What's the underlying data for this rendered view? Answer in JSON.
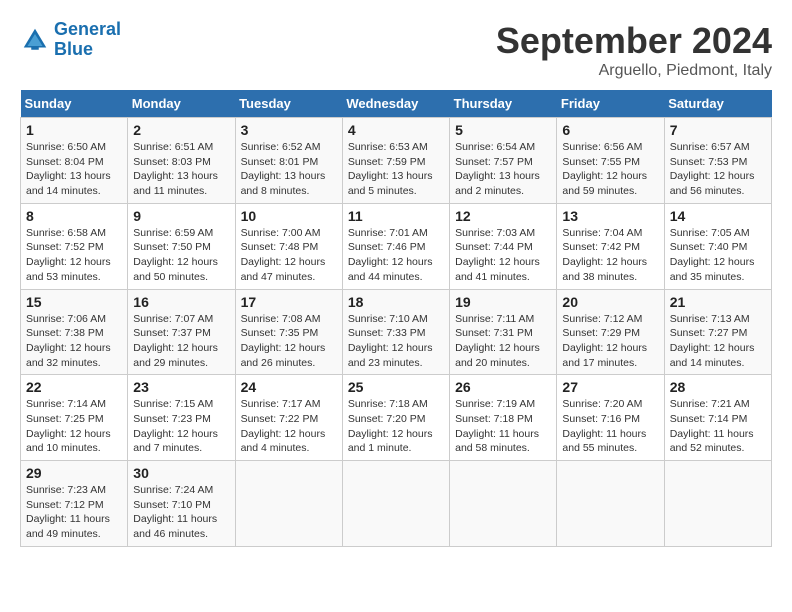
{
  "header": {
    "logo_line1": "General",
    "logo_line2": "Blue",
    "month": "September 2024",
    "location": "Arguello, Piedmont, Italy"
  },
  "weekdays": [
    "Sunday",
    "Monday",
    "Tuesday",
    "Wednesday",
    "Thursday",
    "Friday",
    "Saturday"
  ],
  "weeks": [
    [
      {
        "day": "1",
        "rise": "Sunrise: 6:50 AM",
        "set": "Sunset: 8:04 PM",
        "daylight": "Daylight: 13 hours and 14 minutes."
      },
      {
        "day": "2",
        "rise": "Sunrise: 6:51 AM",
        "set": "Sunset: 8:03 PM",
        "daylight": "Daylight: 13 hours and 11 minutes."
      },
      {
        "day": "3",
        "rise": "Sunrise: 6:52 AM",
        "set": "Sunset: 8:01 PM",
        "daylight": "Daylight: 13 hours and 8 minutes."
      },
      {
        "day": "4",
        "rise": "Sunrise: 6:53 AM",
        "set": "Sunset: 7:59 PM",
        "daylight": "Daylight: 13 hours and 5 minutes."
      },
      {
        "day": "5",
        "rise": "Sunrise: 6:54 AM",
        "set": "Sunset: 7:57 PM",
        "daylight": "Daylight: 13 hours and 2 minutes."
      },
      {
        "day": "6",
        "rise": "Sunrise: 6:56 AM",
        "set": "Sunset: 7:55 PM",
        "daylight": "Daylight: 12 hours and 59 minutes."
      },
      {
        "day": "7",
        "rise": "Sunrise: 6:57 AM",
        "set": "Sunset: 7:53 PM",
        "daylight": "Daylight: 12 hours and 56 minutes."
      }
    ],
    [
      {
        "day": "8",
        "rise": "Sunrise: 6:58 AM",
        "set": "Sunset: 7:52 PM",
        "daylight": "Daylight: 12 hours and 53 minutes."
      },
      {
        "day": "9",
        "rise": "Sunrise: 6:59 AM",
        "set": "Sunset: 7:50 PM",
        "daylight": "Daylight: 12 hours and 50 minutes."
      },
      {
        "day": "10",
        "rise": "Sunrise: 7:00 AM",
        "set": "Sunset: 7:48 PM",
        "daylight": "Daylight: 12 hours and 47 minutes."
      },
      {
        "day": "11",
        "rise": "Sunrise: 7:01 AM",
        "set": "Sunset: 7:46 PM",
        "daylight": "Daylight: 12 hours and 44 minutes."
      },
      {
        "day": "12",
        "rise": "Sunrise: 7:03 AM",
        "set": "Sunset: 7:44 PM",
        "daylight": "Daylight: 12 hours and 41 minutes."
      },
      {
        "day": "13",
        "rise": "Sunrise: 7:04 AM",
        "set": "Sunset: 7:42 PM",
        "daylight": "Daylight: 12 hours and 38 minutes."
      },
      {
        "day": "14",
        "rise": "Sunrise: 7:05 AM",
        "set": "Sunset: 7:40 PM",
        "daylight": "Daylight: 12 hours and 35 minutes."
      }
    ],
    [
      {
        "day": "15",
        "rise": "Sunrise: 7:06 AM",
        "set": "Sunset: 7:38 PM",
        "daylight": "Daylight: 12 hours and 32 minutes."
      },
      {
        "day": "16",
        "rise": "Sunrise: 7:07 AM",
        "set": "Sunset: 7:37 PM",
        "daylight": "Daylight: 12 hours and 29 minutes."
      },
      {
        "day": "17",
        "rise": "Sunrise: 7:08 AM",
        "set": "Sunset: 7:35 PM",
        "daylight": "Daylight: 12 hours and 26 minutes."
      },
      {
        "day": "18",
        "rise": "Sunrise: 7:10 AM",
        "set": "Sunset: 7:33 PM",
        "daylight": "Daylight: 12 hours and 23 minutes."
      },
      {
        "day": "19",
        "rise": "Sunrise: 7:11 AM",
        "set": "Sunset: 7:31 PM",
        "daylight": "Daylight: 12 hours and 20 minutes."
      },
      {
        "day": "20",
        "rise": "Sunrise: 7:12 AM",
        "set": "Sunset: 7:29 PM",
        "daylight": "Daylight: 12 hours and 17 minutes."
      },
      {
        "day": "21",
        "rise": "Sunrise: 7:13 AM",
        "set": "Sunset: 7:27 PM",
        "daylight": "Daylight: 12 hours and 14 minutes."
      }
    ],
    [
      {
        "day": "22",
        "rise": "Sunrise: 7:14 AM",
        "set": "Sunset: 7:25 PM",
        "daylight": "Daylight: 12 hours and 10 minutes."
      },
      {
        "day": "23",
        "rise": "Sunrise: 7:15 AM",
        "set": "Sunset: 7:23 PM",
        "daylight": "Daylight: 12 hours and 7 minutes."
      },
      {
        "day": "24",
        "rise": "Sunrise: 7:17 AM",
        "set": "Sunset: 7:22 PM",
        "daylight": "Daylight: 12 hours and 4 minutes."
      },
      {
        "day": "25",
        "rise": "Sunrise: 7:18 AM",
        "set": "Sunset: 7:20 PM",
        "daylight": "Daylight: 12 hours and 1 minute."
      },
      {
        "day": "26",
        "rise": "Sunrise: 7:19 AM",
        "set": "Sunset: 7:18 PM",
        "daylight": "Daylight: 11 hours and 58 minutes."
      },
      {
        "day": "27",
        "rise": "Sunrise: 7:20 AM",
        "set": "Sunset: 7:16 PM",
        "daylight": "Daylight: 11 hours and 55 minutes."
      },
      {
        "day": "28",
        "rise": "Sunrise: 7:21 AM",
        "set": "Sunset: 7:14 PM",
        "daylight": "Daylight: 11 hours and 52 minutes."
      }
    ],
    [
      {
        "day": "29",
        "rise": "Sunrise: 7:23 AM",
        "set": "Sunset: 7:12 PM",
        "daylight": "Daylight: 11 hours and 49 minutes."
      },
      {
        "day": "30",
        "rise": "Sunrise: 7:24 AM",
        "set": "Sunset: 7:10 PM",
        "daylight": "Daylight: 11 hours and 46 minutes."
      },
      {
        "day": "",
        "rise": "",
        "set": "",
        "daylight": ""
      },
      {
        "day": "",
        "rise": "",
        "set": "",
        "daylight": ""
      },
      {
        "day": "",
        "rise": "",
        "set": "",
        "daylight": ""
      },
      {
        "day": "",
        "rise": "",
        "set": "",
        "daylight": ""
      },
      {
        "day": "",
        "rise": "",
        "set": "",
        "daylight": ""
      }
    ]
  ]
}
